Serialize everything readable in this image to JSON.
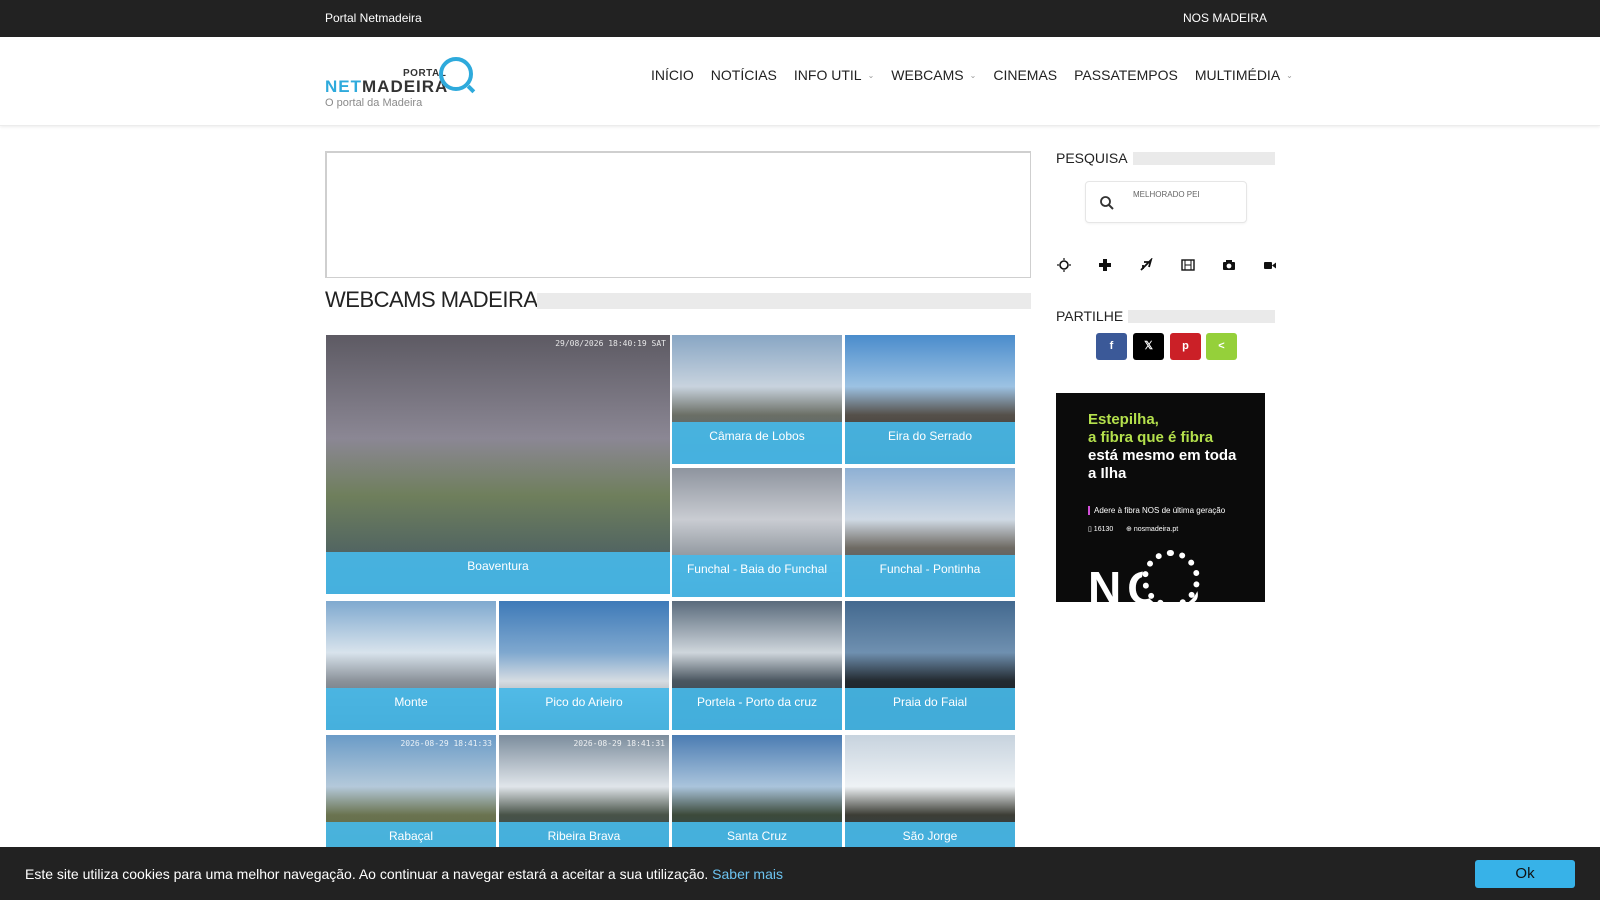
{
  "topbar": {
    "left_label": "Portal Netmadeira",
    "right_label": "NOS MADEIRA"
  },
  "logo": {
    "portal": "PORTAL",
    "net": "NET",
    "madeira": "MADEIRA",
    "tagline": "O portal da Madeira"
  },
  "nav": {
    "items": [
      {
        "label": "INÍCIO",
        "has_caret": false
      },
      {
        "label": "NOTÍCIAS",
        "has_caret": false
      },
      {
        "label": "INFO UTIL",
        "has_caret": true
      },
      {
        "label": "WEBCAMS",
        "has_caret": true
      },
      {
        "label": "CINEMAS",
        "has_caret": false
      },
      {
        "label": "PASSATEMPOS",
        "has_caret": false
      },
      {
        "label": "MULTIMÉDIA",
        "has_caret": true
      }
    ],
    "caret_glyph": "⌄"
  },
  "main": {
    "title": "WEBCAMS MADEIRA",
    "webcams": [
      {
        "name": "Boaventura",
        "stamp": "29/08/2026 18:40:19 SAT"
      },
      {
        "name": "Câmara de Lobos",
        "stamp": ""
      },
      {
        "name": "Eira do Serrado",
        "stamp": ""
      },
      {
        "name": "Funchal - Baia do Funchal",
        "stamp": ""
      },
      {
        "name": "Funchal - Pontinha",
        "stamp": ""
      },
      {
        "name": "Monte",
        "stamp": ""
      },
      {
        "name": "Pico do Arieiro",
        "stamp": ""
      },
      {
        "name": "Portela - Porto da cruz",
        "stamp": ""
      },
      {
        "name": "Praia do Faial",
        "stamp": ""
      },
      {
        "name": "Rabaçal",
        "stamp": "2026-08-29 18:41:33"
      },
      {
        "name": "Ribeira Brava",
        "stamp": "2026-08-29 18:41:31"
      },
      {
        "name": "Santa Cruz",
        "stamp": ""
      },
      {
        "name": "São Jorge",
        "stamp": ""
      }
    ]
  },
  "sidebar": {
    "search_title": "PESQUISA",
    "search_placeholder": "MELHORADO PELO GOOGLE",
    "quick_icons": [
      "sun-icon",
      "cross-icon",
      "plane-icon",
      "film-icon",
      "camera-icon",
      "video-icon"
    ],
    "share_title": "PARTILHE",
    "share_buttons": [
      {
        "name": "facebook",
        "glyph": "f",
        "color": "#3b5998"
      },
      {
        "name": "x",
        "glyph": "𝕏",
        "color": "#000000"
      },
      {
        "name": "pinterest",
        "glyph": "p",
        "color": "#cb2027"
      },
      {
        "name": "sharethis",
        "glyph": "<",
        "color": "#95d03a"
      }
    ]
  },
  "promo": {
    "line1": "Estepilha,",
    "line1b": "a fibra que é fibra",
    "line2": "está mesmo em toda a Ilha",
    "line3": "Adere à fibra NOS de última geração",
    "phone": "16130",
    "site": "nosmadeira.pt",
    "brand": "NOS",
    "accent": "#b4e04c"
  },
  "cookie": {
    "message": "Este site utiliza cookies para uma melhor navegação. Ao continuar a navegar estará a aceitar a sua utilização.",
    "link": "Saber mais",
    "button": "Ok"
  },
  "colors": {
    "accent": "#2eaadc",
    "label_bg": "#46b9e8",
    "topbar": "#222222"
  }
}
